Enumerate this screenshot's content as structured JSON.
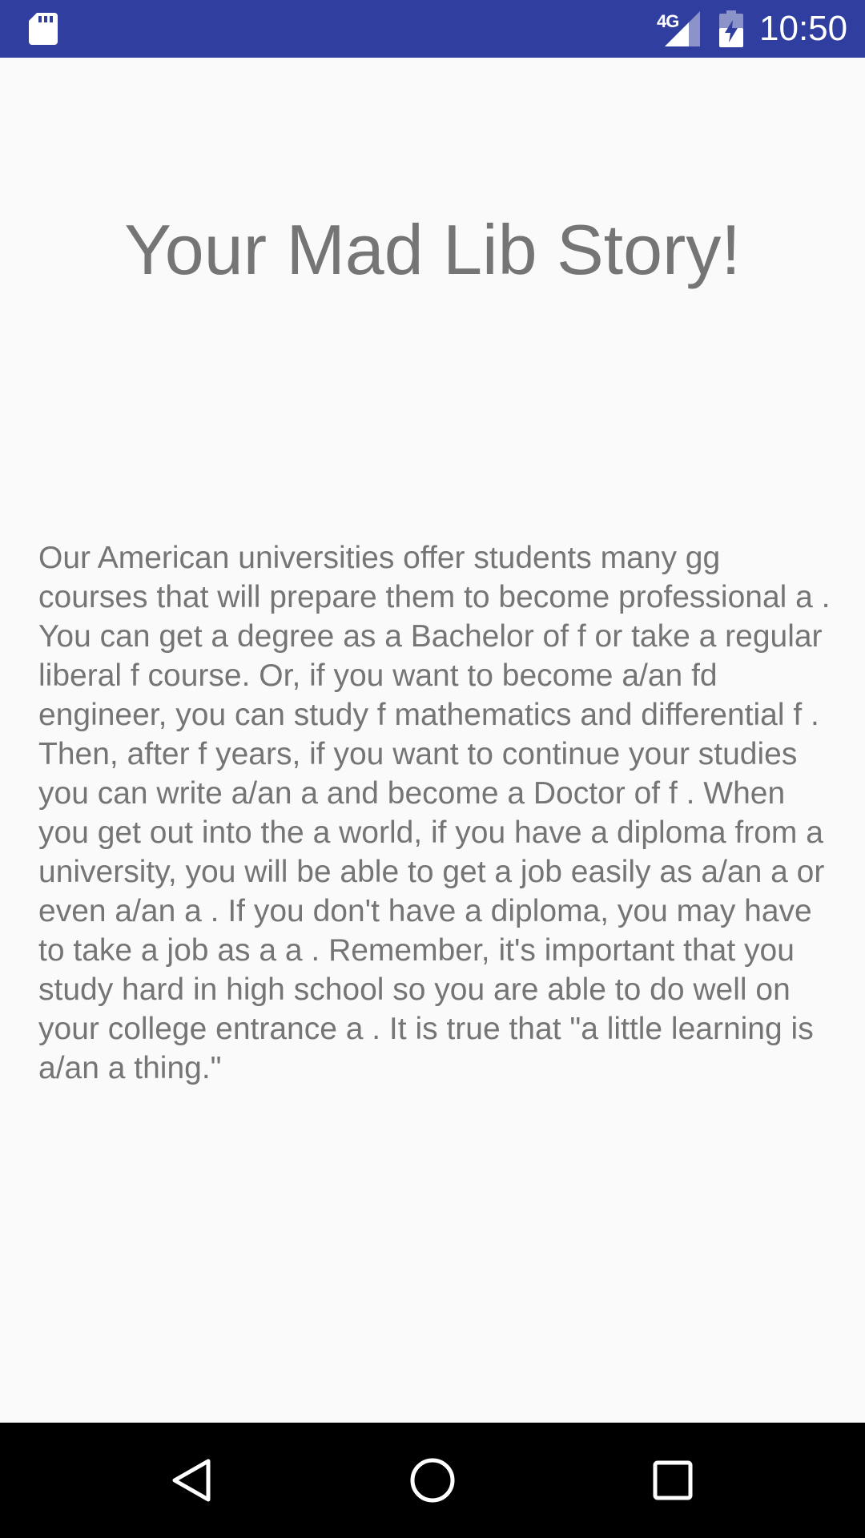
{
  "status_bar": {
    "network": "4G",
    "time": "10:50"
  },
  "page": {
    "title": "Your Mad Lib Story!",
    "story": "Our American universities offer students many gg courses that will prepare them to become professional a . You can get a degree as a Bachelor of f or take a regular liberal f course. Or, if you want to become a/an fd engineer, you can study f mathematics and differential f . Then, after f years, if you want to continue your studies you can write a/an a and become a Doctor of f . When you get out into the a world, if you have a diploma from a university, you will be able to get a job easily as a/an a or even a/an a . If you don't have a diploma, you may have to take a job as a a . Remember, it's important that you study hard in high school so you are able to do well on your college entrance a . It is true that \"a little learning is a/an a thing.\""
  },
  "nav_bar": {
    "buttons": [
      "back",
      "home",
      "recents"
    ]
  },
  "colors": {
    "status_bar_bg": "#303f9f",
    "background": "#fafafa",
    "text": "#757575",
    "nav_bar_bg": "#000000"
  }
}
